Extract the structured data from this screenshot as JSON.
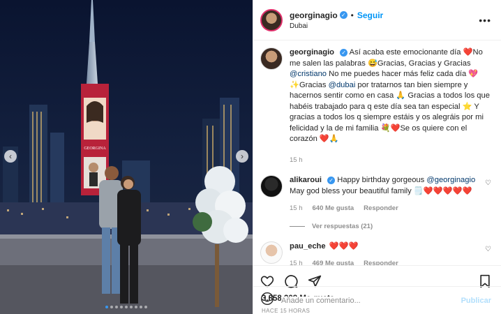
{
  "post": {
    "username": "georginagio",
    "follow_label": "Seguir",
    "separator": "•",
    "location": "Dubai",
    "more_label": "•••"
  },
  "caption": {
    "username": "georginagio",
    "parts": [
      "Así acaba este emocionante día ",
      "❤️",
      "No me salen las palabras ",
      "😅",
      "Gracias, Gracias y Gracias ",
      "@cristiano",
      " No me puedes hacer más feliz cada día ",
      "💖",
      "✨",
      "Gracias ",
      "@dubai",
      " por tratarnos tan bien siempre y hacernos sentir como en casa ",
      "🙏",
      " Gracias a todos los que habéis trabajado para q este día sea tan especial ",
      "⭐",
      " Y gracias a todos los q siempre estáis y os alegráis por mi felicidad y la de mi familia ",
      "💐",
      "❤️",
      "Se os quiere con el corazón ",
      "❤️",
      "🙏"
    ],
    "time": "15 h"
  },
  "comments": [
    {
      "username": "alikaroui",
      "text_before": "Happy birthday gorgeous ",
      "mention": "@georginagio",
      "text_after": " May god bless your beautiful family ",
      "emoji": "🗒️❤️❤️❤️❤️❤️",
      "time": "15 h",
      "likes": "640 Me gusta",
      "reply_label": "Responder",
      "view_replies": "Ver respuestas (21)"
    },
    {
      "username": "pau_eche",
      "emoji": "❤️❤️❤️",
      "time": "15 h",
      "likes": "469 Me gusta",
      "reply_label": "Responder"
    }
  ],
  "actions": {
    "like_icon": "heart-icon",
    "comment_icon": "comment-icon",
    "share_icon": "send-icon",
    "save_icon": "bookmark-icon"
  },
  "likes_count": "3.858.308 Me gusta",
  "timestamp": "HACE 15 HORAS",
  "add_comment": {
    "placeholder": "Añade un comentario...",
    "publish_label": "Publicar"
  },
  "media": {
    "projection_caption": "GEORGINA",
    "carousel_count": 9,
    "carousel_active": 0
  }
}
